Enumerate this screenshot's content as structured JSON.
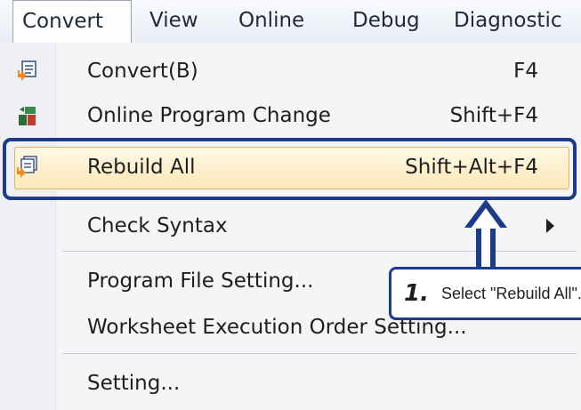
{
  "menubar": {
    "items": [
      {
        "label": "Convert",
        "active": true
      },
      {
        "label": "View"
      },
      {
        "label": "Online"
      },
      {
        "label": "Debug"
      },
      {
        "label": "Diagnostic"
      }
    ]
  },
  "menu": {
    "items": [
      {
        "label": "Convert(B)",
        "shortcut": "F4",
        "icon": "convert-icon"
      },
      {
        "label": "Online Program Change",
        "shortcut": "Shift+F4",
        "icon": "online-program-change-icon"
      },
      {
        "label": "Rebuild All",
        "shortcut": "Shift+Alt+F4",
        "icon": "rebuild-all-icon",
        "highlighted": true
      },
      {
        "label": "Check Syntax",
        "submenu": true
      },
      {
        "label": "Program File Setting..."
      },
      {
        "label": "Worksheet Execution Order Setting..."
      },
      {
        "label": "Setting..."
      }
    ]
  },
  "callout": {
    "number": "1.",
    "text": "Select \"Rebuild All\"."
  },
  "colors": {
    "callout_border": "#1e3a8a",
    "highlight_border": "#e0b560",
    "highlight_fill": "#fde8b8"
  }
}
